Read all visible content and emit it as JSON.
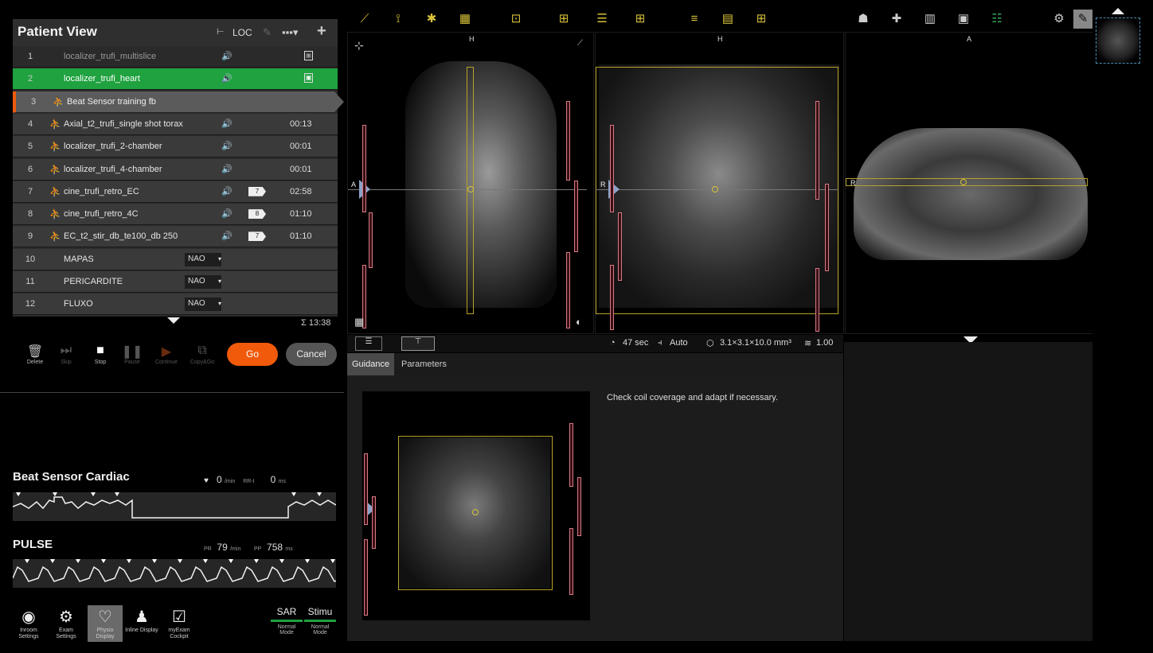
{
  "patient_view": {
    "title": "Patient View",
    "loc_label": "LOC",
    "rows": [
      {
        "num": "1",
        "name": "localizer_trufi_multislice",
        "time": "",
        "tag": "",
        "state": "done"
      },
      {
        "num": "2",
        "name": "localizer_trufi_heart",
        "time": "",
        "tag": "",
        "state": "running"
      },
      {
        "num": "3",
        "name": "Beat Sensor training fb",
        "time": "",
        "tag": "",
        "state": "current"
      },
      {
        "num": "4",
        "name": "Axial_t2_trufi_single shot torax",
        "time": "00:13",
        "tag": "",
        "state": "queued"
      },
      {
        "num": "5",
        "name": "localizer_trufi_2-chamber",
        "time": "00:01",
        "tag": "",
        "state": "queued"
      },
      {
        "num": "6",
        "name": "localizer_trufi_4-chamber",
        "time": "00:01",
        "tag": "",
        "state": "queued"
      },
      {
        "num": "7",
        "name": "cine_trufi_retro_EC",
        "time": "02:58",
        "tag": "7",
        "state": "queued"
      },
      {
        "num": "8",
        "name": "cine_trufi_retro_4C",
        "time": "01:10",
        "tag": "8",
        "state": "queued"
      },
      {
        "num": "9",
        "name": "EC_t2_stir_db_te100_db 250",
        "time": "01:10",
        "tag": "7",
        "state": "queued"
      },
      {
        "num": "10",
        "name": "MAPAS",
        "select": "NAO",
        "state": "group"
      },
      {
        "num": "11",
        "name": "PERICARDITE",
        "select": "NAO",
        "state": "group"
      },
      {
        "num": "12",
        "name": "FLUXO",
        "select": "NAO",
        "state": "group"
      }
    ],
    "total_time": "Σ 13:38"
  },
  "controls": {
    "delete": "Delete",
    "skip": "Skip",
    "stop": "Stop",
    "pause": "Pause",
    "continue": "Continue",
    "copy": "Copy&Go",
    "go": "Go",
    "cancel": "Cancel"
  },
  "beat_sensor": {
    "title": "Beat Sensor Cardiac",
    "hr": "0",
    "hr_unit": "/min",
    "rr_label": "RR-I",
    "rr": "0",
    "rr_unit": "ms"
  },
  "pulse": {
    "title": "PULSE",
    "pr_label": "PR",
    "pr": "79",
    "pr_unit": "/min",
    "pp_label": "PP",
    "pp": "758",
    "pp_unit": "ms"
  },
  "bottom_bar": {
    "inroom": "Inroom Settings",
    "exam": "Exam Settings",
    "physio": "Physio Display",
    "inline": "Inline Display",
    "myexam": "myExam Cockpit",
    "sar": "SAR",
    "sar_mode": "Normal Mode",
    "stimu": "Stimu",
    "stimu_mode": "Normal Mode"
  },
  "viewports": {
    "v1_header": "H",
    "v2_header": "H",
    "v3_header": "A",
    "v1_side": "A",
    "v2_side": "R",
    "v3_side": "R"
  },
  "status": {
    "time": "47 sec",
    "mode": "Auto",
    "resolution": "3.1×3.1×10.0 mm³",
    "factor": "1.00"
  },
  "tabs": {
    "guidance": "Guidance",
    "parameters": "Parameters"
  },
  "guidance_text": "Check coil coverage and adapt if necessary."
}
